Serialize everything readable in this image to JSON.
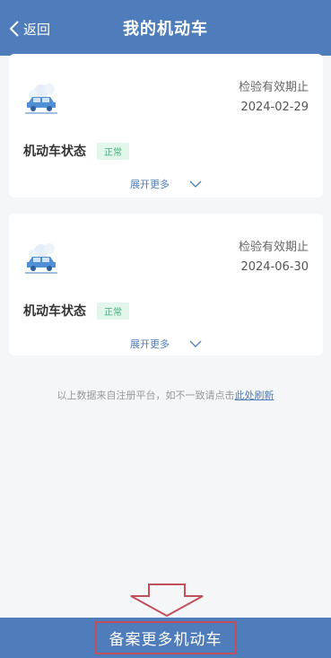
{
  "header": {
    "back_label": "返回",
    "title": "我的机动车"
  },
  "vehicles": [
    {
      "expiry_label": "检验有效期止",
      "expiry_date": "2024-02-29",
      "status_label": "机动车状态",
      "status_value": "正常",
      "expand_label": "展开更多"
    },
    {
      "expiry_label": "检验有效期止",
      "expiry_date": "2024-06-30",
      "status_label": "机动车状态",
      "status_value": "正常",
      "expand_label": "展开更多"
    }
  ],
  "notice": {
    "text": "以上数据来自注册平台，如不一致请点击",
    "link": "此处刷新"
  },
  "bottom": {
    "button_label": "备案更多机动车"
  },
  "colors": {
    "primary": "#4f7dbb",
    "status_green": "#3fb37a",
    "highlight_red": "#c0505a"
  }
}
